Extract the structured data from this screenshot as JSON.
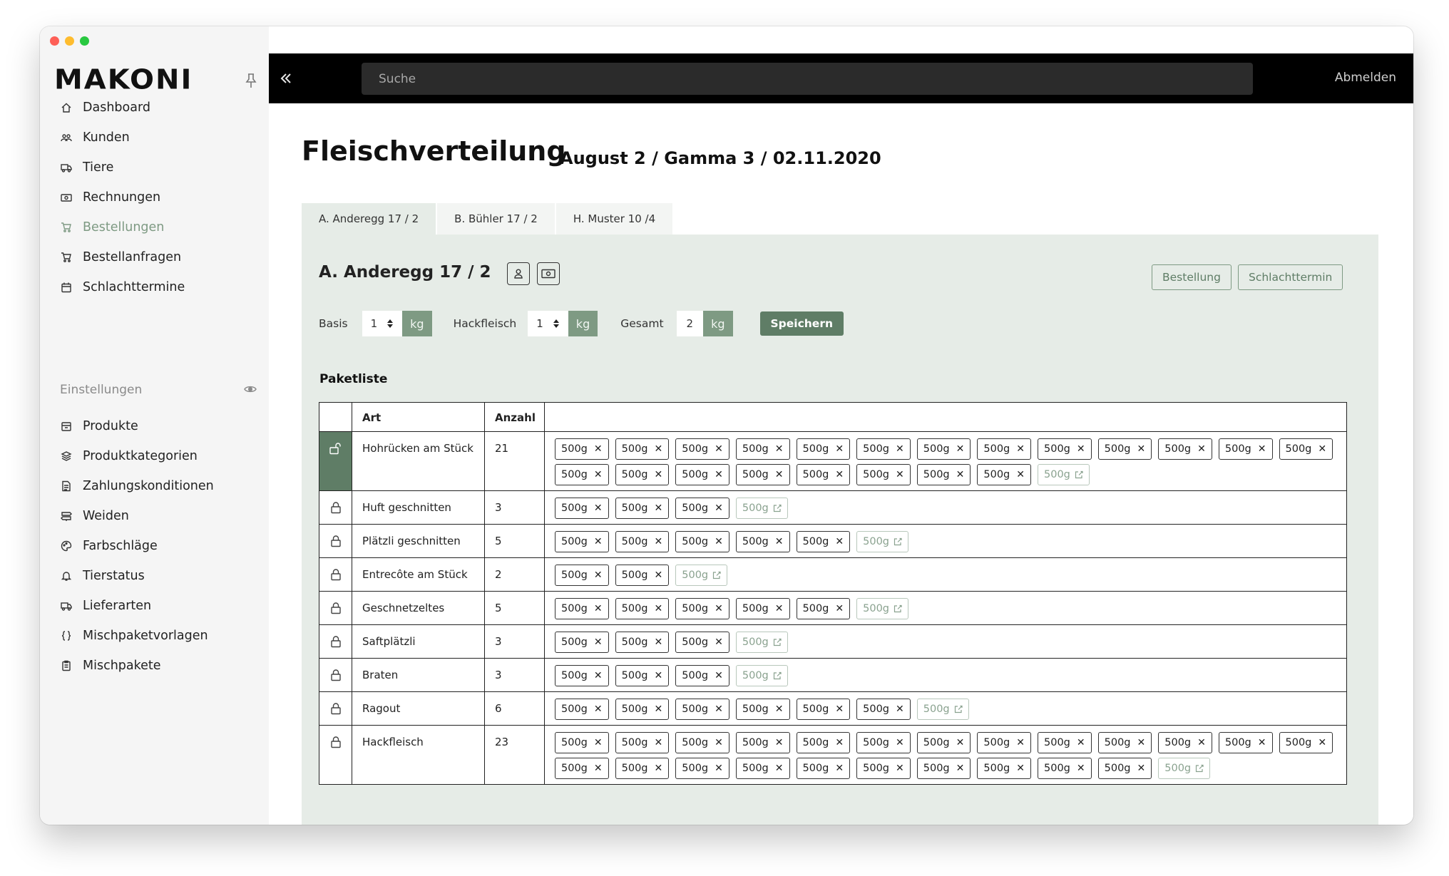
{
  "app": {
    "logo": "MAKONI"
  },
  "sidebar": {
    "nav": [
      {
        "label": "Dashboard",
        "icon": "home-icon",
        "muted": false
      },
      {
        "label": "Kunden",
        "icon": "users-icon",
        "muted": false
      },
      {
        "label": "Tiere",
        "icon": "truck-icon",
        "muted": false
      },
      {
        "label": "Rechnungen",
        "icon": "banknote-icon",
        "muted": false
      },
      {
        "label": "Bestellungen",
        "icon": "cart-icon",
        "muted": true
      },
      {
        "label": "Bestellanfragen",
        "icon": "cart-icon",
        "muted": false
      },
      {
        "label": "Schlachttermine",
        "icon": "calendar-icon",
        "muted": false
      }
    ],
    "settings_label": "Einstellungen",
    "settings": [
      {
        "label": "Produkte",
        "icon": "box-icon"
      },
      {
        "label": "Produktkategorien",
        "icon": "layers-icon"
      },
      {
        "label": "Zahlungskonditionen",
        "icon": "document-icon"
      },
      {
        "label": "Weiden",
        "icon": "signpost-icon"
      },
      {
        "label": "Farbschläge",
        "icon": "palette-icon"
      },
      {
        "label": "Tierstatus",
        "icon": "bell-icon"
      },
      {
        "label": "Lieferarten",
        "icon": "truck-icon"
      },
      {
        "label": "Mischpaketvorlagen",
        "icon": "braces-icon"
      },
      {
        "label": "Mischpakete",
        "icon": "clipboard-icon"
      }
    ]
  },
  "topbar": {
    "search_placeholder": "Suche",
    "logout": "Abmelden"
  },
  "page": {
    "title": "Fleischverteilung",
    "subtitle": "August 2 / Gamma 3 / 02.11.2020"
  },
  "tabs": [
    {
      "label": "A. Anderegg 17 / 2",
      "active": true
    },
    {
      "label": "B. Bühler 17 / 2",
      "active": false
    },
    {
      "label": "H. Muster 10 /4",
      "active": false
    }
  ],
  "customer": {
    "name": "A. Anderegg 17 / 2",
    "btn_order": "Bestellung",
    "btn_slaughter": "Schlachttermin"
  },
  "quantities": {
    "basis_label": "Basis",
    "basis_value": "1",
    "hack_label": "Hackfleisch",
    "hack_value": "1",
    "total_label": "Gesamt",
    "total_value": "2",
    "unit": "kg",
    "save": "Speichern"
  },
  "paketliste": {
    "title": "Paketliste",
    "col_art": "Art",
    "col_anzahl": "Anzahl",
    "chip_label": "500g",
    "rows": [
      {
        "art": "Hohrücken am Stück",
        "anzahl": "21",
        "unlocked": true
      },
      {
        "art": "Huft geschnitten",
        "anzahl": "3",
        "unlocked": false
      },
      {
        "art": "Plätzli geschnitten",
        "anzahl": "5",
        "unlocked": false
      },
      {
        "art": "Entrecôte am Stück",
        "anzahl": "2",
        "unlocked": false
      },
      {
        "art": "Geschnetzeltes",
        "anzahl": "5",
        "unlocked": false
      },
      {
        "art": "Saftplätzli",
        "anzahl": "3",
        "unlocked": false
      },
      {
        "art": "Braten",
        "anzahl": "3",
        "unlocked": false
      },
      {
        "art": "Ragout",
        "anzahl": "6",
        "unlocked": false
      },
      {
        "art": "Hackfleisch",
        "anzahl": "23",
        "unlocked": false
      }
    ]
  },
  "colors": {
    "accent": "#5f7d66",
    "accent_light": "#7e9a83",
    "panel": "#e6ece7"
  }
}
